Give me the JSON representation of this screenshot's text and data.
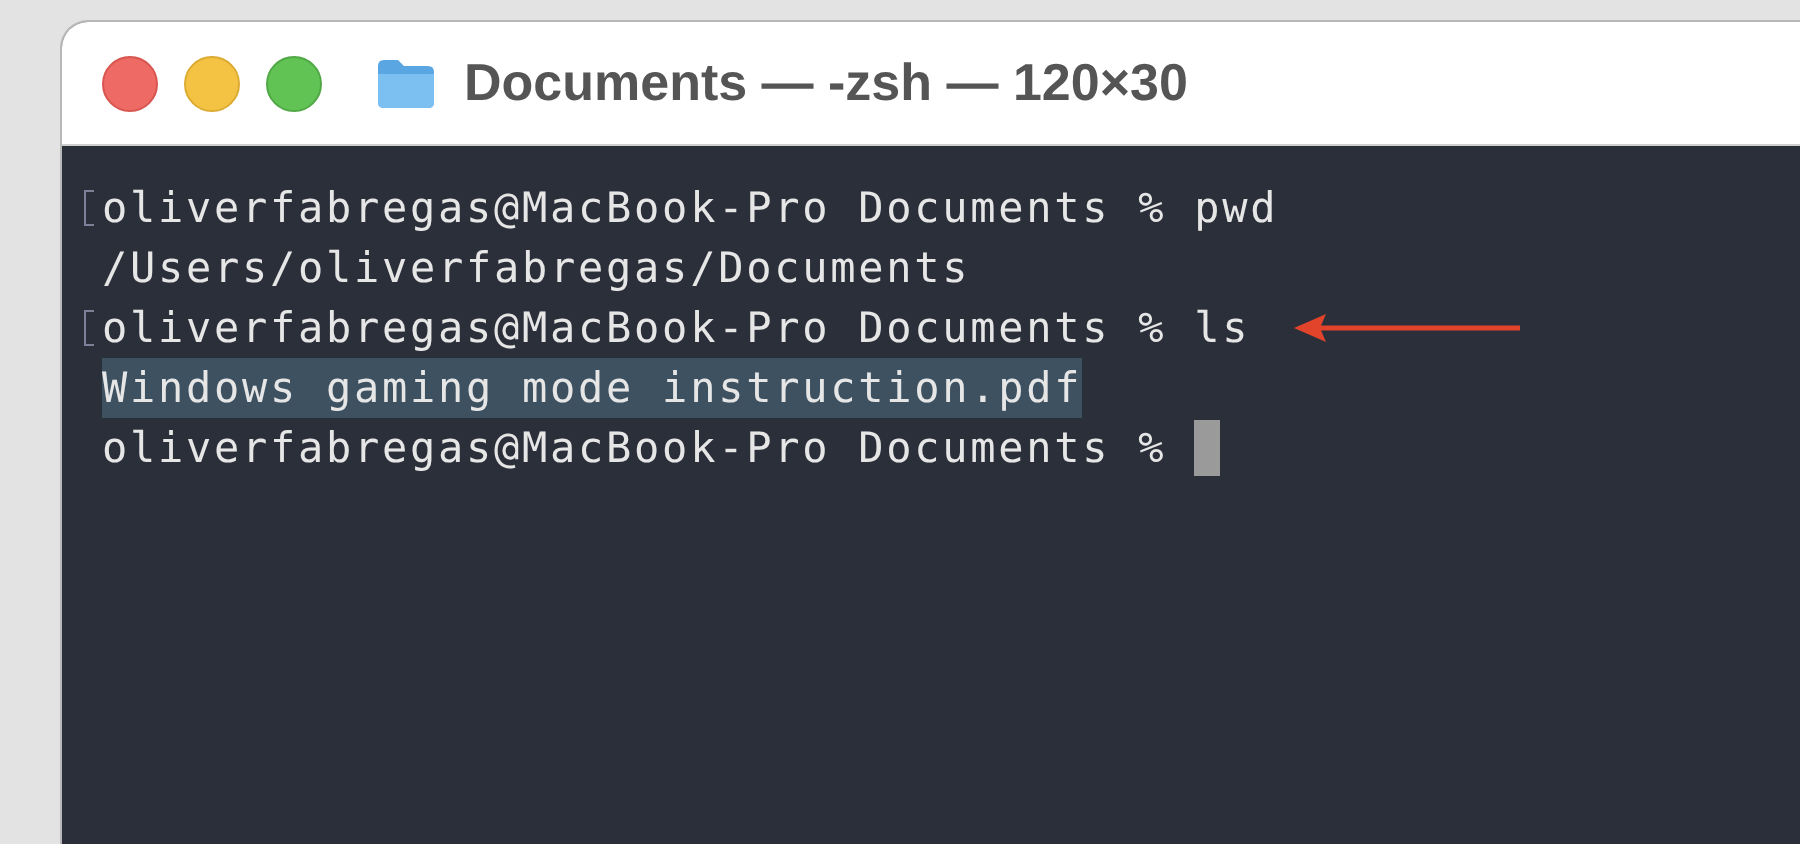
{
  "window": {
    "title": "Documents — -zsh — 120×30"
  },
  "terminal": {
    "lines": [
      {
        "text": "oliverfabregas@MacBook-Pro Documents % pwd",
        "marked": true,
        "selected": false,
        "cursor": false,
        "annotated": false
      },
      {
        "text": "/Users/oliverfabregas/Documents",
        "marked": false,
        "selected": false,
        "cursor": false,
        "annotated": false
      },
      {
        "text": "oliverfabregas@MacBook-Pro Documents % ls",
        "marked": true,
        "selected": false,
        "cursor": false,
        "annotated": true
      },
      {
        "text": "Windows gaming mode instruction.pdf",
        "marked": false,
        "selected": true,
        "cursor": false,
        "annotated": false
      },
      {
        "text": "oliverfabregas@MacBook-Pro Documents %",
        "marked": false,
        "selected": false,
        "cursor": true,
        "annotated": false
      }
    ]
  }
}
